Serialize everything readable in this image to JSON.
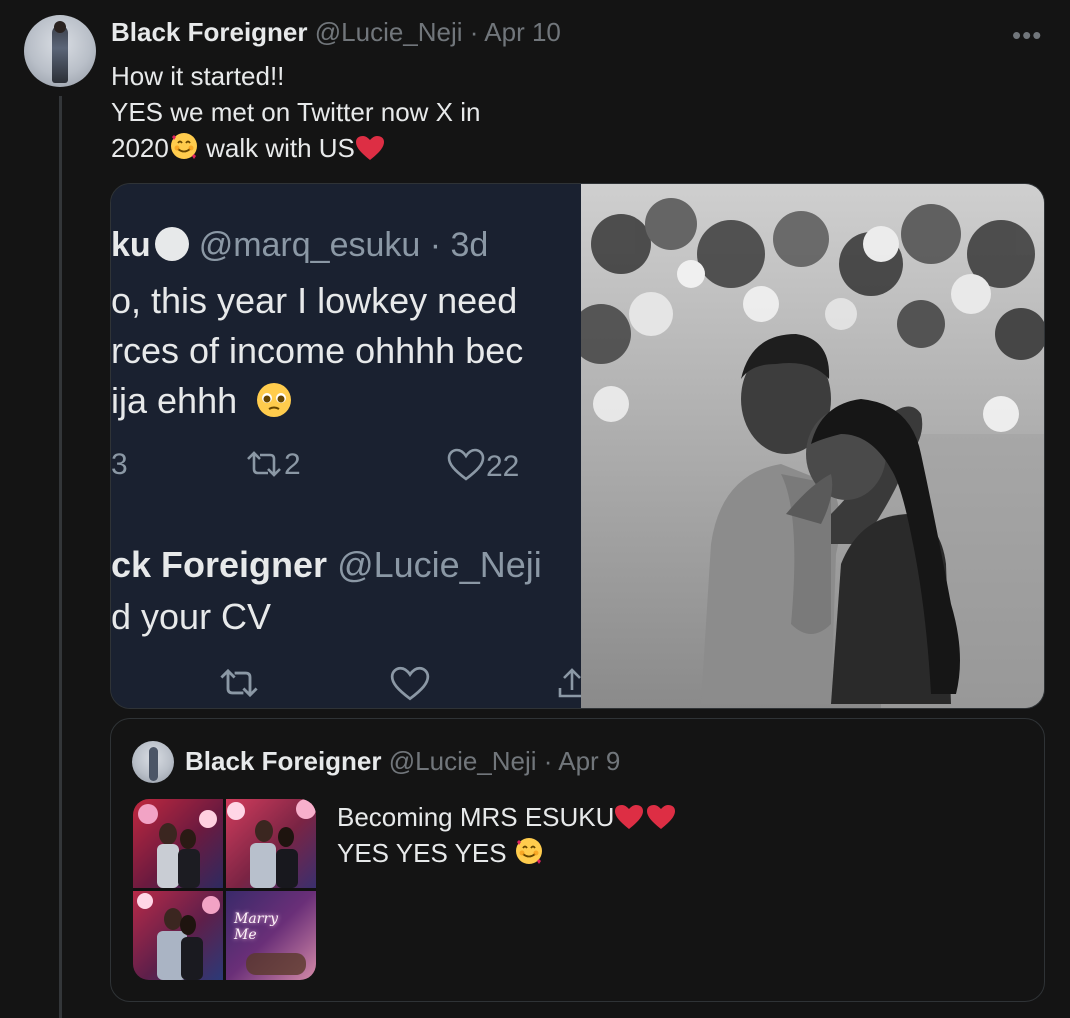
{
  "tweet": {
    "author_name": "Black Foreigner",
    "author_handle": "@Lucie_Neji",
    "date_separator": "·",
    "date": "Apr 10",
    "more_label": "•••",
    "text_lines": [
      "How it started!!",
      "YES we met on Twitter now X in",
      "2020",
      "walk with US"
    ]
  },
  "screenshot": {
    "handle_prefix": "ku",
    "handle": "@marq_esuku · 3d",
    "lines": [
      "o, this year  I lowkey need",
      "rces of income ohhhh bec",
      "ija ehhh"
    ],
    "retweet_count": "2",
    "like_count": "22",
    "left_edge_count": "3",
    "reply_author": "ck Foreigner",
    "reply_handle": "@Lucie_Neji",
    "reply_line": "d your CV"
  },
  "quote": {
    "author_name": "Black Foreigner",
    "author_handle": "@Lucie_Neji",
    "date": "· Apr 9",
    "text_lines": [
      "Becoming MRS ESUKU",
      "YES YES YES "
    ],
    "neon_text": "Marry Me"
  },
  "colors": {
    "background": "#141414",
    "text": "#e7e9ea",
    "muted": "#71767b",
    "heart": "#e0245e",
    "border": "#2f3336"
  },
  "icons": [
    "more-icon",
    "heart-emoji-icon",
    "smiling-face-hearts-icon",
    "retweet-icon",
    "like-icon",
    "pleading-face-icon",
    "share-icon"
  ]
}
